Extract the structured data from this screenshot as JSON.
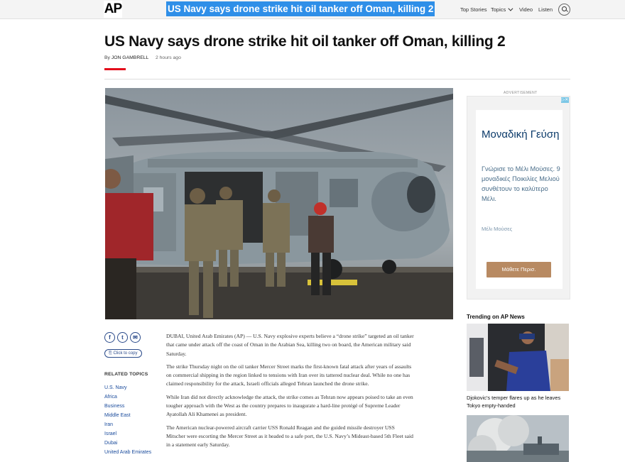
{
  "topbar": {
    "logo": "AP",
    "headline": "US Navy says drone strike hit oil tanker off Oman, killing 2",
    "nav": [
      "Top Stories",
      "Topics",
      "Video",
      "Listen"
    ]
  },
  "article": {
    "title": "US Navy says drone strike hit oil tanker off Oman, killing 2",
    "byline_prefix": "By",
    "author": "JON GAMBRELL",
    "time": "2 hours ago",
    "paragraphs": [
      "DUBAI, United Arab Emirates (AP) — U.S. Navy explosive experts believe a “drone strike” targeted an oil tanker that came under attack off the coast of Oman in the Arabian Sea, killing two on board, the American military said Saturday.",
      "The strike Thursday night on the oil tanker Mercer Street marks the first-known fatal attack after years of assaults on commercial shipping in the region linked to tensions with Iran over its tattered nuclear deal. While no one has claimed responsibility for the attack, Israeli officials alleged Tehran launched the drone strike.",
      "While Iran did not directly acknowledge the attack, the strike comes as Tehran now appears poised to take an even tougher approach with the West as the country prepares to inaugurate a hard-line protégé of Supreme Leader Ayatollah Ali Khamenei as president.",
      "The American nuclear-powered aircraft carrier USS Ronald Reagan and the guided missile destroyer USS Mitscher were escorting the Mercer Street as it headed to a safe port, the U.S. Navy’s Mideast-based 5th Fleet said in a statement early Saturday."
    ]
  },
  "share": {
    "copy_label": "Click to copy",
    "icons": [
      "facebook-icon",
      "twitter-icon",
      "email-icon",
      "link-icon"
    ]
  },
  "related": {
    "title": "RELATED TOPICS",
    "items": [
      "U.S. Navy",
      "Africa",
      "Business",
      "Middle East",
      "Iran",
      "Israel",
      "Dubai",
      "United Arab Emirates"
    ]
  },
  "ad": {
    "label": "ADVERTISEMENT",
    "close": "▷✕",
    "title": "Μοναδική Γεύση",
    "description": "Γνώρισε το Μέλι Μούσες. 9 μοναδικές Ποικιλίες Μελιού συνθέτουν το καλύτερο Μέλι.",
    "brand": "Μέλι Μούσες",
    "cta": "Μάθετε Περισ."
  },
  "trending": {
    "title": "Trending on AP News",
    "items": [
      {
        "caption": "Djokovic’s temper flares up as he leaves Tokyo empty-handed"
      }
    ]
  },
  "colors": {
    "accent_red": "#e30b1b",
    "link_blue": "#1a4b9c",
    "highlight_blue": "#2f8fe8"
  }
}
